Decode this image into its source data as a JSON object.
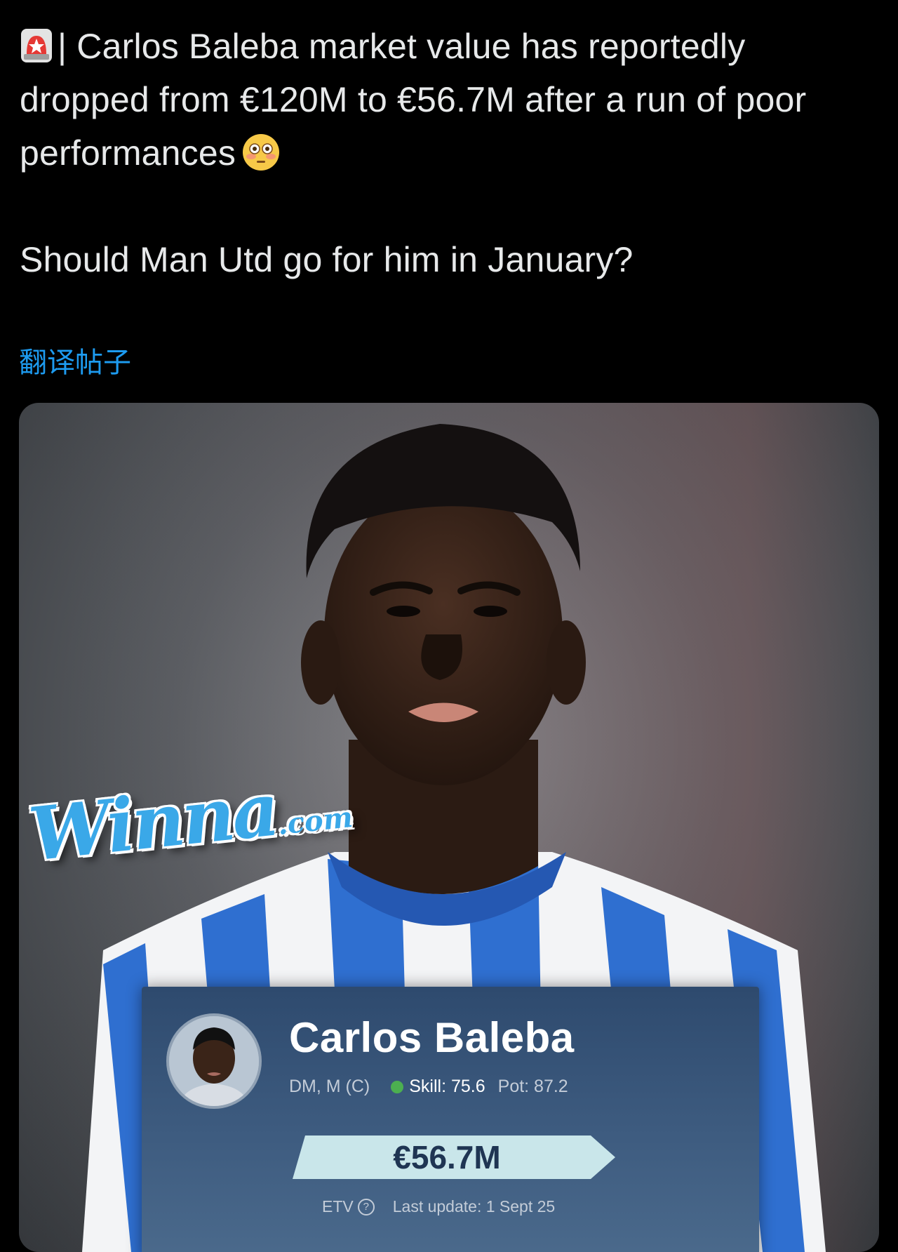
{
  "tweet": {
    "emoji_prefix": "siren-emoji",
    "line1": "| Carlos Baleba market value has reportedly dropped from €120M to €56.7M after a run of poor performances",
    "emoji_suffix": "flushed-face-emoji",
    "line2": "Should Man Utd go for him in January?",
    "translate_link": "翻译帖子"
  },
  "media": {
    "watermark_main": "Winna",
    "watermark_suffix": ".com",
    "card": {
      "player_name": "Carlos Baleba",
      "positions": "DM, M (C)",
      "skill": "Skill: 75.6",
      "potential": "Pot: 87.2",
      "value": "€56.7M",
      "etv_label": "ETV",
      "help_icon": "?",
      "last_update": "Last update: 1 Sept 25"
    }
  },
  "colors": {
    "background": "#000000",
    "text": "#e7e9ea",
    "link": "#1d9bf0",
    "card_bg": "#2e4a6e",
    "value_banner": "#c9e6ea",
    "skill_dot": "#4caf50"
  }
}
